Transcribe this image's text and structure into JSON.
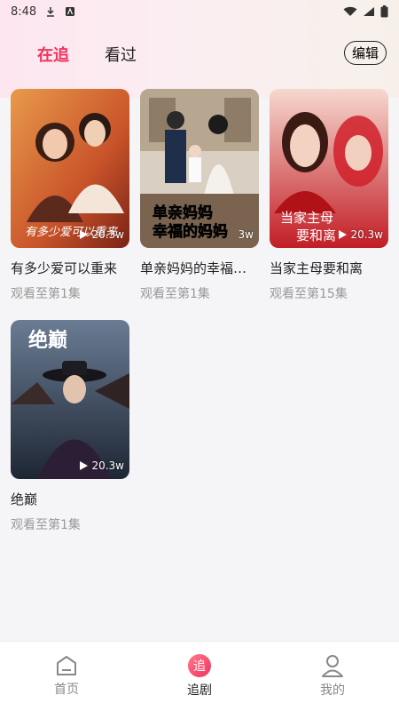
{
  "status_bar": {
    "time": "8:48"
  },
  "tabs": [
    {
      "label": "在追",
      "active": true
    },
    {
      "label": "看过",
      "active": false
    }
  ],
  "edit_label": "编辑",
  "items": [
    {
      "title": "有多少爱可以重来",
      "progress": "观看至第1集",
      "views": "20.3w",
      "poster_text": "有多少爱可以重来"
    },
    {
      "title": "单亲妈妈的幸福…",
      "progress": "观看至第1集",
      "views": "3w",
      "poster_text": "单亲妈妈 幸福的妈妈"
    },
    {
      "title": "当家主母要和离",
      "progress": "观看至第15集",
      "views": "20.3w",
      "poster_text": "当家主母要和离"
    },
    {
      "title": "绝巅",
      "progress": "观看至第1集",
      "views": "20.3w",
      "poster_text": "绝巅"
    }
  ],
  "nav": [
    {
      "label": "首页",
      "icon": "home-icon"
    },
    {
      "label": "追剧",
      "icon": "follow-icon",
      "badge": "追"
    },
    {
      "label": "我的",
      "icon": "profile-icon"
    }
  ],
  "colors": {
    "accent": "#f0335f"
  }
}
